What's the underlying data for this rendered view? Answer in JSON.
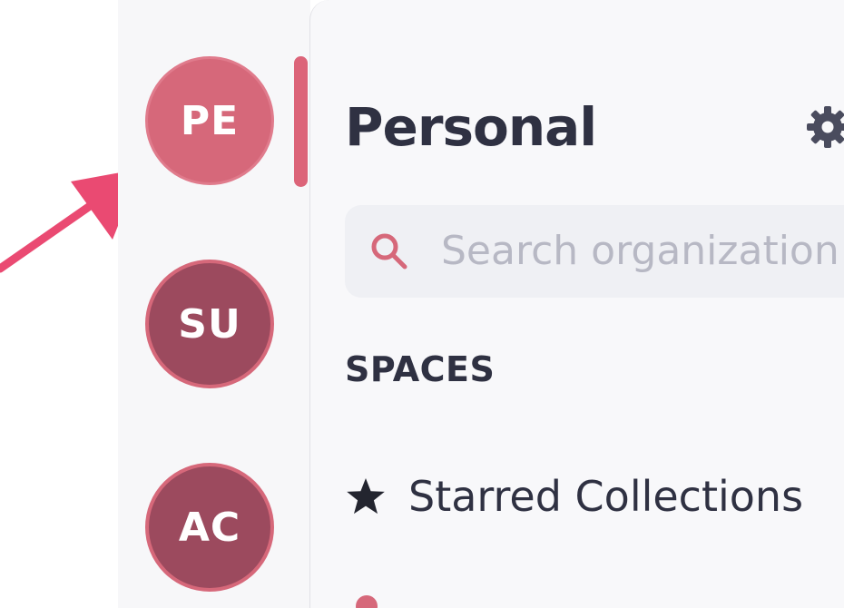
{
  "colors": {
    "accent": "#dc6479",
    "avatar_active": "#d6687a",
    "avatar_inactive": "#9c4a5e",
    "text_primary": "#2f3142",
    "placeholder": "#b7b8c4"
  },
  "organizations": [
    {
      "initials": "PE",
      "active": true
    },
    {
      "initials": "SU",
      "active": false
    },
    {
      "initials": "AC",
      "active": false
    }
  ],
  "panel": {
    "title": "Personal",
    "settings_icon": "gear-icon"
  },
  "search": {
    "placeholder": "Search organization",
    "value": "",
    "icon": "search-icon"
  },
  "spaces": {
    "heading": "SPACES",
    "items": [
      {
        "label": "Starred Collections",
        "icon": "star-icon"
      }
    ]
  }
}
